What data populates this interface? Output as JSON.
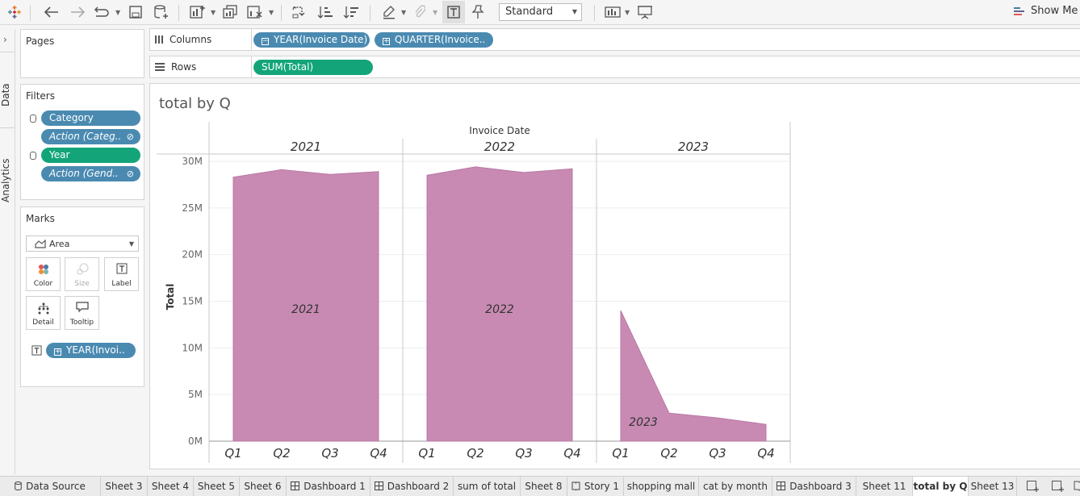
{
  "toolbar": {
    "view_size": "Standard",
    "show_me_label": "Show Me"
  },
  "side_panel": {
    "data_tab": "Data",
    "analytics_tab": "Analytics"
  },
  "pages": {
    "title": "Pages"
  },
  "filters": {
    "title": "Filters",
    "items": [
      {
        "label": "Category",
        "style": "blue"
      },
      {
        "label": "Action (Categ..",
        "style": "blue-italic"
      },
      {
        "label": "Year",
        "style": "green"
      },
      {
        "label": "Action (Gend..",
        "style": "blue-italic"
      }
    ]
  },
  "marks": {
    "title": "Marks",
    "type": "Area",
    "buttons": [
      "Color",
      "Size",
      "Label",
      "Detail",
      "Tooltip"
    ],
    "field": "YEAR(Invoi.."
  },
  "columns_shelf": {
    "label": "Columns",
    "pills": [
      "YEAR(Invoice Date)",
      "QUARTER(Invoice.."
    ]
  },
  "rows_shelf": {
    "label": "Rows",
    "pills": [
      "SUM(Total)"
    ]
  },
  "sheet": {
    "title": "total by Q"
  },
  "chart_data": {
    "type": "area",
    "title": "total by Q",
    "column_header": "Invoice Date",
    "ylabel": "Total",
    "ylim": [
      0,
      30000000
    ],
    "yticks": [
      "0M",
      "5M",
      "10M",
      "15M",
      "20M",
      "25M",
      "30M"
    ],
    "ytick_values": [
      0,
      5000000,
      10000000,
      15000000,
      20000000,
      25000000,
      30000000
    ],
    "panes": [
      "2021",
      "2022",
      "2023"
    ],
    "categories": [
      "Q1",
      "Q2",
      "Q3",
      "Q4"
    ],
    "series": [
      {
        "name": "2021",
        "values": [
          28300000,
          29100000,
          28600000,
          28900000
        ]
      },
      {
        "name": "2022",
        "values": [
          28500000,
          29400000,
          28800000,
          29200000
        ]
      },
      {
        "name": "2023",
        "values": [
          14000000,
          3000000,
          2500000,
          1800000
        ]
      }
    ],
    "mark_labels": [
      "2021",
      "2022",
      "2023"
    ],
    "color": "#c88ab3"
  },
  "tabs": [
    {
      "label": "Data Source",
      "icon": "database-icon"
    },
    {
      "label": "Sheet 3"
    },
    {
      "label": "Sheet 4"
    },
    {
      "label": "Sheet 5"
    },
    {
      "label": "Sheet 6"
    },
    {
      "label": "Dashboard 1",
      "icon": "dashboard-icon"
    },
    {
      "label": "Dashboard 2",
      "icon": "dashboard-icon"
    },
    {
      "label": "sum of total"
    },
    {
      "label": "Sheet 8"
    },
    {
      "label": "Story 1",
      "icon": "story-icon"
    },
    {
      "label": "shopping mall"
    },
    {
      "label": "cat by month"
    },
    {
      "label": "Dashboard 3",
      "icon": "dashboard-icon"
    },
    {
      "label": "Sheet 11"
    },
    {
      "label": "total by Q",
      "active": true
    },
    {
      "label": "Sheet 13"
    }
  ]
}
